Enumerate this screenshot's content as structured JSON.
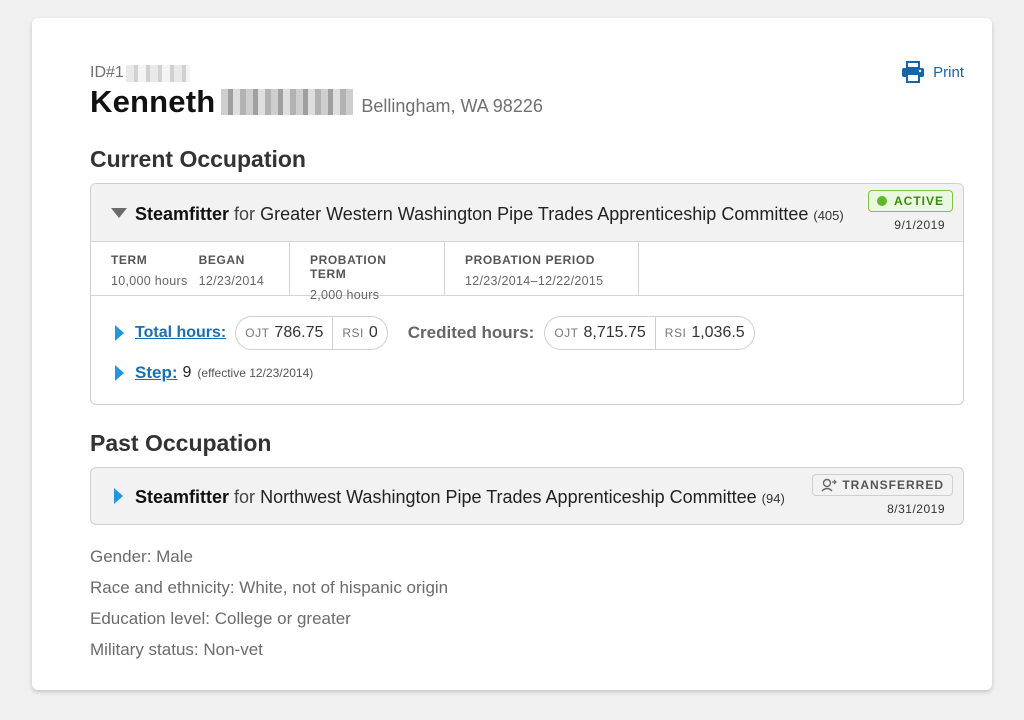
{
  "profile": {
    "id_prefix": "ID#1",
    "first_name": "Kenneth",
    "location": "Bellingham, WA 98226"
  },
  "actions": {
    "print_label": "Print",
    "print_icon": "printer-icon"
  },
  "current_occupation": {
    "section_title": "Current Occupation",
    "trade": "Steamfitter",
    "connector": "for",
    "committee": "Greater Western Washington Pipe Trades Apprenticeship Committee",
    "committee_number": "(405)",
    "status": "ACTIVE",
    "status_color": "#5eb82a",
    "status_date": "9/1/2019",
    "term": {
      "label": "TERM",
      "value": "10,000 hours"
    },
    "began": {
      "label": "BEGAN",
      "value": "12/23/2014"
    },
    "probation_term": {
      "label": "PROBATION TERM",
      "value": "2,000 hours"
    },
    "probation_period": {
      "label": "PROBATION PERIOD",
      "value": "12/23/2014–12/22/2015"
    },
    "total_hours": {
      "label": "Total hours:",
      "ojt_label": "OJT",
      "ojt_value": "786.75",
      "rsi_label": "RSI",
      "rsi_value": "0"
    },
    "credited_hours": {
      "label": "Credited hours:",
      "ojt_label": "OJT",
      "ojt_value": "8,715.75",
      "rsi_label": "RSI",
      "rsi_value": "1,036.5"
    },
    "step": {
      "label": "Step:",
      "value": "9",
      "effective": "(effective 12/23/2014)"
    }
  },
  "past_occupation": {
    "section_title": "Past Occupation",
    "trade": "Steamfitter",
    "connector": "for",
    "committee": "Northwest Washington Pipe Trades Apprenticeship Committee",
    "committee_number": "(94)",
    "status": "TRANSFERRED",
    "status_date": "8/31/2019"
  },
  "demographics": {
    "gender": "Gender: Male",
    "race": "Race and ethnicity: White, not of hispanic origin",
    "education": "Education level: College or greater",
    "military": "Military status: Non-vet"
  },
  "colors": {
    "link": "#1a6fb3",
    "accent_triangle": "#2196e3"
  }
}
